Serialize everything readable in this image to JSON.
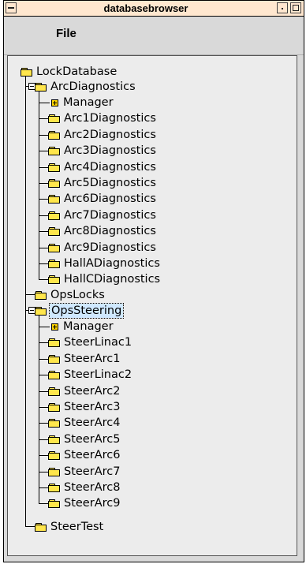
{
  "window": {
    "title": "databasebrowser"
  },
  "menubar": {
    "file": "File"
  },
  "tree": {
    "root": "LockDatabase",
    "arc_diagnostics": {
      "label": "ArcDiagnostics",
      "children": [
        "Manager",
        "Arc1Diagnostics",
        "Arc2Diagnostics",
        "Arc3Diagnostics",
        "Arc4Diagnostics",
        "Arc5Diagnostics",
        "Arc6Diagnostics",
        "Arc7Diagnostics",
        "Arc8Diagnostics",
        "Arc9Diagnostics",
        "HallADiagnostics",
        "HallCDiagnostics"
      ]
    },
    "ops_locks": "OpsLocks",
    "ops_steering": {
      "label": "OpsSteering",
      "children": [
        "Manager",
        "SteerLinac1",
        "SteerArc1",
        "SteerLinac2",
        "SteerArc2",
        "SteerArc3",
        "SteerArc4",
        "SteerArc5",
        "SteerArc6",
        "SteerArc7",
        "SteerArc8",
        "SteerArc9"
      ]
    },
    "steer_test": "SteerTest"
  }
}
